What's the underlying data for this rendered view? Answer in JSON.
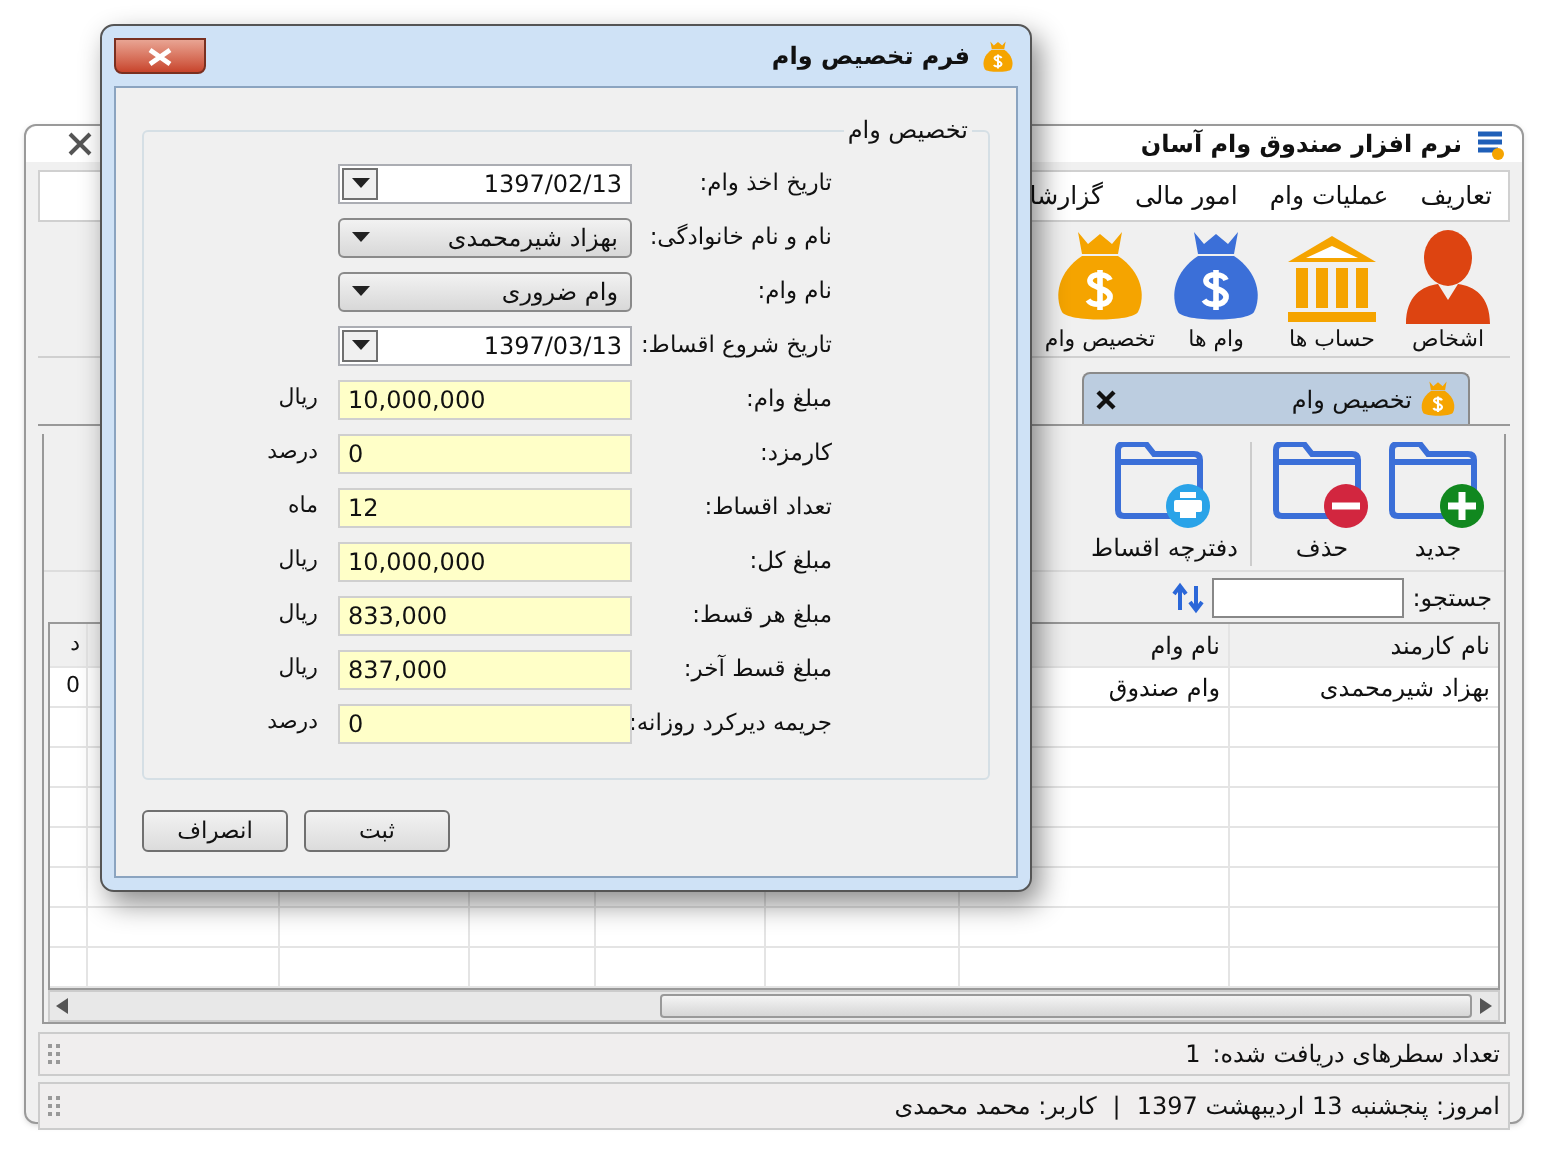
{
  "main_window": {
    "title": "نرم افزار صندوق وام آسان",
    "menu": [
      {
        "label": "تعاریف"
      },
      {
        "label": "عملیات وام"
      },
      {
        "label": "امور مالی"
      },
      {
        "label": "گزارشا"
      }
    ],
    "ribbon": [
      {
        "label": "اشخاص",
        "kind": "person"
      },
      {
        "label": "حساب ها",
        "kind": "bank"
      },
      {
        "label": "وام ها",
        "kind": "bag_blue"
      },
      {
        "label": "تخصیص وام",
        "kind": "bag_orange"
      }
    ],
    "tabs": [
      {
        "label": "تخصیص وام",
        "selected": true
      }
    ],
    "toolbar": [
      {
        "label": "جدید",
        "kind": "add"
      },
      {
        "label": "حذف",
        "kind": "delete"
      },
      {
        "label": "دفترچه اقساط",
        "kind": "print"
      }
    ],
    "search": {
      "label": "جستجو:"
    },
    "table": {
      "columns": [
        "نام کارمند",
        "نام وام",
        "د"
      ],
      "rows": [
        [
          "بهزاد شیرمحمدی",
          "وام صندوق",
          "0"
        ]
      ]
    },
    "status_bar": {
      "label": "تعداد سطرهای دریافت شده:",
      "count": "1"
    },
    "footer": {
      "date": "امروز: پنجشنبه 13 اردیبهشت 1397",
      "separator": "|",
      "user": "کاربر: محمد محمدی"
    }
  },
  "dialog": {
    "title": "فرم تخصیص وام",
    "group": "تخصیص وام",
    "fields": [
      {
        "label": "تاریخ اخذ وام:",
        "kind": "date",
        "value": "1397/02/13"
      },
      {
        "label": "نام و نام خانوادگی:",
        "kind": "combo",
        "value": "بهزاد شیرمحمدی"
      },
      {
        "label": "نام وام:",
        "kind": "combo",
        "value": "وام ضروری"
      },
      {
        "label": "تاریخ شروع اقساط:",
        "kind": "date",
        "value": "1397/03/13"
      },
      {
        "label": "مبلغ وام:",
        "kind": "text",
        "value": "10,000,000",
        "unit": "ریال"
      },
      {
        "label": "کارمزد:",
        "kind": "text",
        "value": "0",
        "unit": "درصد"
      },
      {
        "label": "تعداد اقساط:",
        "kind": "text",
        "value": "12",
        "unit": "ماه"
      },
      {
        "label": "مبلغ کل:",
        "kind": "text",
        "value": "10,000,000",
        "unit": "ریال"
      },
      {
        "label": "مبلغ هر قسط:",
        "kind": "text",
        "value": "833,000",
        "unit": "ریال"
      },
      {
        "label": "مبلغ قسط آخر:",
        "kind": "text",
        "value": "837,000",
        "unit": "ریال"
      },
      {
        "label": "جریمه دیرکرد روزانه:",
        "kind": "text",
        "value": "0",
        "unit": "درصد"
      }
    ],
    "buttons": [
      "ثبت",
      "انصراف"
    ]
  }
}
